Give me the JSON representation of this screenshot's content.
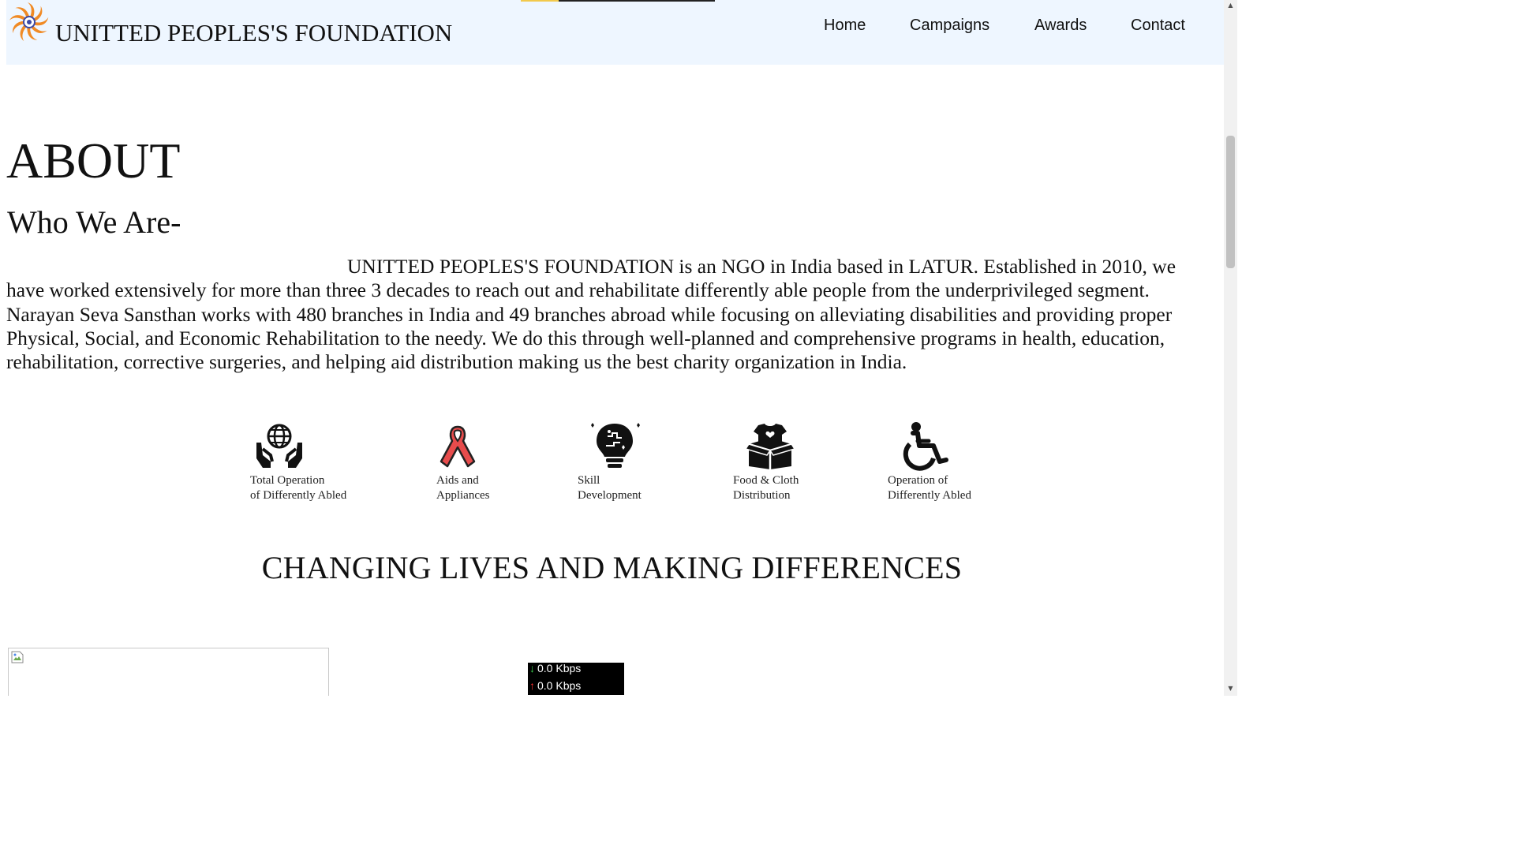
{
  "header": {
    "title": "UNITTED PEOPLES'S FOUNDATION",
    "logo_icon": "sun-spiral-logo-icon",
    "nav": [
      {
        "label": "Home"
      },
      {
        "label": "Campaigns"
      },
      {
        "label": "Awards"
      },
      {
        "label": "Contact"
      }
    ]
  },
  "about": {
    "title": "ABOUT",
    "subtitle": "Who We Are-",
    "paragraph": "UNITTED PEOPLES'S FOUNDATION is an NGO in India based in LATUR. Established in 2010, we have worked extensively for more than three 3 decades to reach out and rehabilitate differently able people from the underprivileged segment. Narayan Seva Sansthan works with 480 branches in India and 49 branches abroad while focusing on alleviating disabilities and providing proper Physical, Social, and Economic Rehabilitation to the needy. We do this through well-planned and comprehensive programs in health, education, rehabilitation, corrective surgeries, and helping aid distribution making us the best charity organization in India."
  },
  "features": [
    {
      "caption": "Total Operation\nof Differently Abled",
      "icon": "globe-in-hands-icon"
    },
    {
      "caption": "Aids and\nAppliances",
      "icon": "awareness-ribbon-icon"
    },
    {
      "caption": "Skill\n Development",
      "icon": "puzzle-lightbulb-icon"
    },
    {
      "caption": "Food & Cloth\nDistribution",
      "icon": "donation-box-icon"
    },
    {
      "caption": "Operation of\nDifferently Abled",
      "icon": "wheelchair-icon"
    }
  ],
  "section_heading": "CHANGING LIVES AND MAKING DIFFERENCES",
  "net_meter": {
    "download": "0.0 Kbps",
    "upload": "0.0 Kbps",
    "down_color": "#3ccf4e",
    "up_color": "#ff3030"
  },
  "colors": {
    "header_bg": "#eef6ff",
    "ribbon": "#e74c4c"
  }
}
